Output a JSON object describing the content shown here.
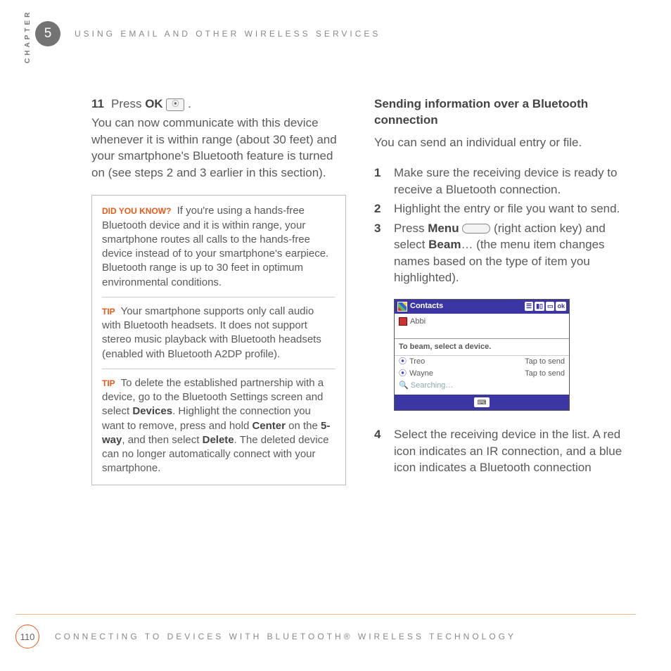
{
  "chapter_number": "5",
  "chapter_label": "CHAPTER",
  "top_title": "USING EMAIL AND OTHER WIRELESS SERVICES",
  "left": {
    "step11_num": "11",
    "step11_prefix": "Press ",
    "step11_bold": "OK",
    "step11_suffix": " .",
    "para1": "You can now communicate with this device whenever it is within range (about 30 feet) and your smartphone's Bluetooth feature is turned on (see steps 2 and 3 earlier in this section).",
    "callouts": {
      "dyk_label": "DID YOU KNOW?",
      "dyk_text": " If you're using a hands-free Bluetooth device and it is within range, your smartphone routes all calls to the hands-free device instead of to your smartphone's earpiece. Bluetooth range is up to 30 feet in optimum environmental conditions.",
      "tip1_label": "TIP",
      "tip1_text": " Your smartphone supports only call audio with Bluetooth headsets. It does not support stereo music playback with Bluetooth headsets (enabled with Bluetooth A2DP profile).",
      "tip2_label": "TIP",
      "tip2_a": " To delete the established partnership with a device, go to the Bluetooth Settings screen and select ",
      "tip2_b": "Devices",
      "tip2_c": ". Highlight the connection you want to remove, press and hold ",
      "tip2_d": "Center",
      "tip2_e": " on the ",
      "tip2_f": "5-way",
      "tip2_g": ", and then select ",
      "tip2_h": "Delete",
      "tip2_i": ". The deleted device can no longer automatically connect with your smartphone."
    }
  },
  "right": {
    "subhead": "Sending information over a Bluetooth connection",
    "intro": "You can send an individual entry or file.",
    "s1_num": "1",
    "s1_text": "Make sure the receiving device is ready to receive a Bluetooth connection.",
    "s2_num": "2",
    "s2_text": "Highlight the entry or file you want to send.",
    "s3_num": "3",
    "s3_a": "Press ",
    "s3_b": "Menu",
    "s3_c": " (right action key) and select ",
    "s3_d": "Beam",
    "s3_e": "… (the menu item changes names based on the type of item you highlighted).",
    "s4_num": "4",
    "s4_text": "Select the receiving device in the list. A red icon indicates an IR connection, and a blue icon indicates a Bluetooth connection"
  },
  "device": {
    "title": "Contacts",
    "ok": "ok",
    "contact": "Abbi",
    "instruction": "To beam, select a device.",
    "rows": [
      {
        "name": "Treo",
        "action": "Tap to send"
      },
      {
        "name": "Wayne",
        "action": "Tap to send"
      }
    ],
    "searching": "Searching…"
  },
  "footer": {
    "page": "110",
    "text": "CONNECTING TO DEVICES WITH BLUETOOTH® WIRELESS TECHNOLOGY"
  }
}
